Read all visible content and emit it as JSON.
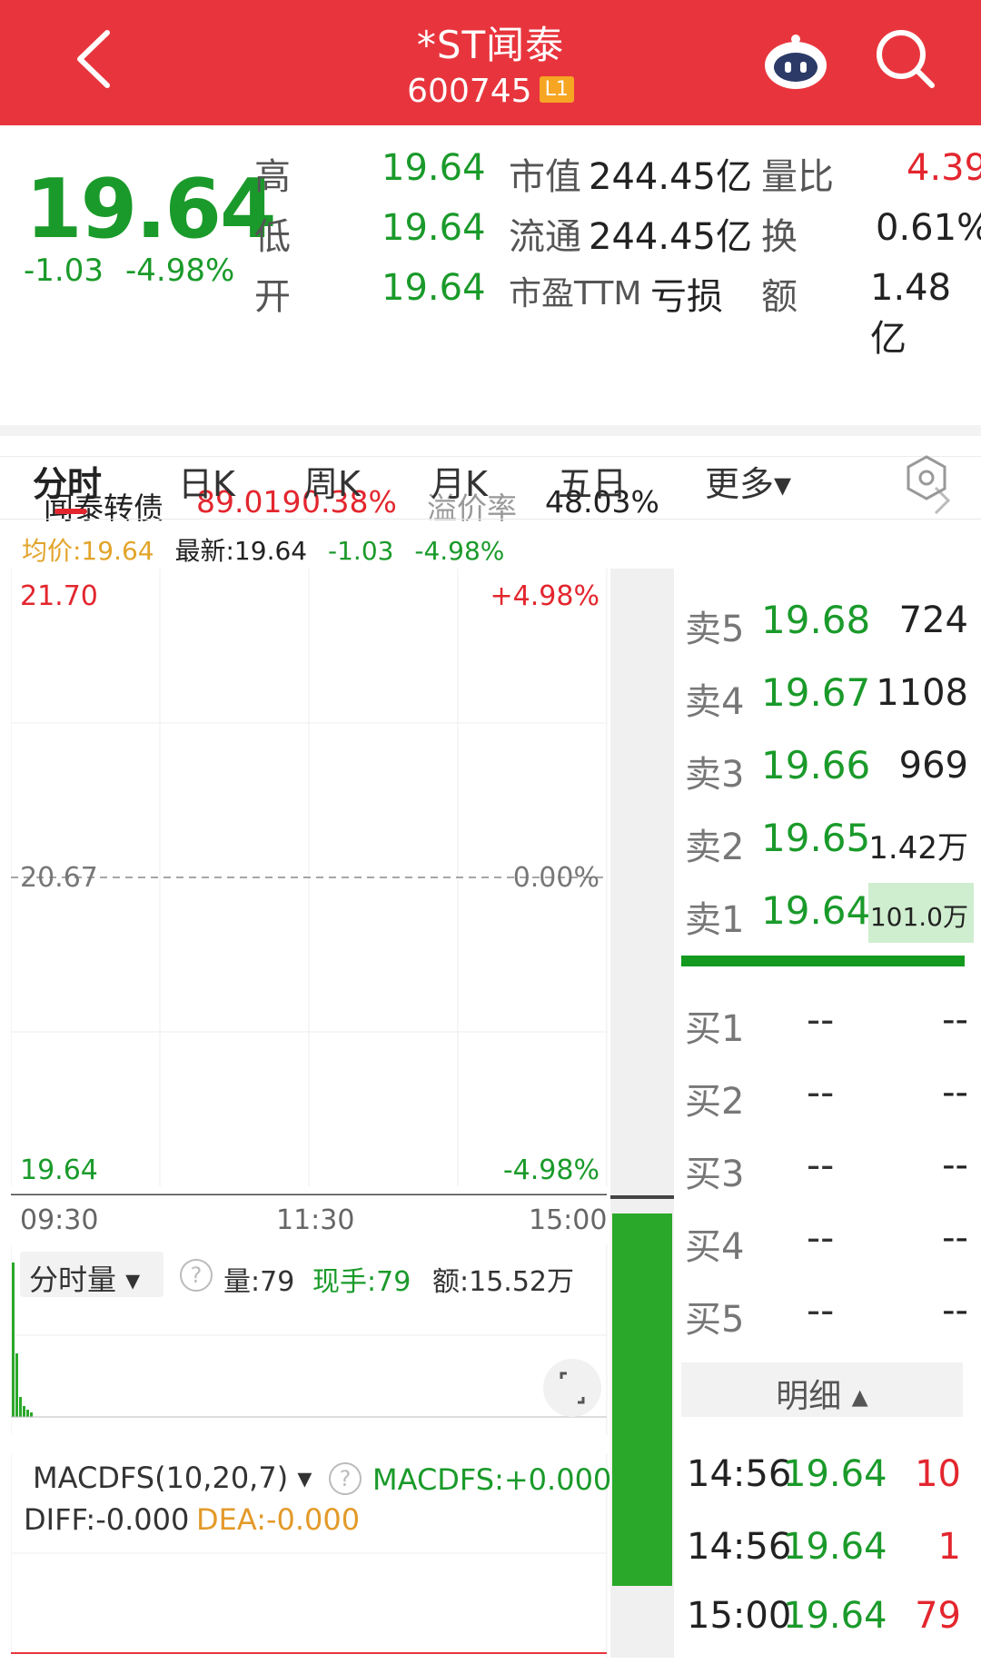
{
  "header": {
    "title": "*ST闻泰",
    "code": "600745",
    "badge": "L1"
  },
  "quote": {
    "price": "19.64",
    "change": "-1.03",
    "change_pct": "-4.98%",
    "rows": [
      {
        "l1": "高",
        "v1": "19.64",
        "l2": "市值",
        "v2": "244.45亿",
        "l3": "量比",
        "v3": "4.39"
      },
      {
        "l1": "低",
        "v1": "19.64",
        "l2": "流通",
        "v2": "244.45亿",
        "l3": "换",
        "v3": "0.61%"
      },
      {
        "l1": "开",
        "v1": "19.64",
        "l2": "市盈TTM",
        "v2": "亏损",
        "l3": "额",
        "v3": "1.48亿"
      }
    ]
  },
  "convertible": {
    "name": "闻泰转债",
    "price": "89.019",
    "pct": "0.38%",
    "premium_label": "溢价率",
    "premium_value": "48.03%"
  },
  "tabs": [
    "分时",
    "日K",
    "周K",
    "月K",
    "五日",
    "更多▾"
  ],
  "info": {
    "avg": "均价:19.64",
    "latest": "最新:19.64",
    "change": "-1.03",
    "pct": "-4.98%"
  },
  "chart": {
    "y_top": "21.70",
    "y_mid": "20.67",
    "y_bot": "19.64",
    "p_top": "+4.98%",
    "p_mid": "0.00%",
    "p_bot": "-4.98%",
    "times": [
      "09:30",
      "11:30",
      "15:00"
    ]
  },
  "volume": {
    "selector": "分时量 ▾",
    "qty": "量:79",
    "now": "现手:79",
    "amount": "额:15.52万"
  },
  "macd": {
    "selector": "MACDFS(10,20,7) ▾",
    "value": "MACDFS:+0.000",
    "diff": "DIFF:-0.000",
    "dea": "DEA:-0.000"
  },
  "orderbook": {
    "sell": [
      {
        "label": "卖5",
        "price": "19.68",
        "vol": "724"
      },
      {
        "label": "卖4",
        "price": "19.67",
        "vol": "1108"
      },
      {
        "label": "卖3",
        "price": "19.66",
        "vol": "969"
      },
      {
        "label": "卖2",
        "price": "19.65",
        "vol": "1.42万"
      },
      {
        "label": "卖1",
        "price": "19.64",
        "vol": "101.0万"
      }
    ],
    "buy": [
      {
        "label": "买1",
        "price": "--",
        "vol": "--"
      },
      {
        "label": "买2",
        "price": "--",
        "vol": "--"
      },
      {
        "label": "买3",
        "price": "--",
        "vol": "--"
      },
      {
        "label": "买4",
        "price": "--",
        "vol": "--"
      },
      {
        "label": "买5",
        "price": "--",
        "vol": "--"
      }
    ]
  },
  "details": {
    "label": "明细 ▴",
    "rows": [
      {
        "time": "14:56",
        "price": "19.64",
        "vol": "10"
      },
      {
        "time": "14:56",
        "price": "19.64",
        "vol": "1"
      },
      {
        "time": "15:00",
        "price": "19.64",
        "vol": "79"
      }
    ]
  },
  "colors": {
    "red": "#e8353d",
    "green": "#1a9a2a",
    "volume_bar": "#2aa82a"
  }
}
